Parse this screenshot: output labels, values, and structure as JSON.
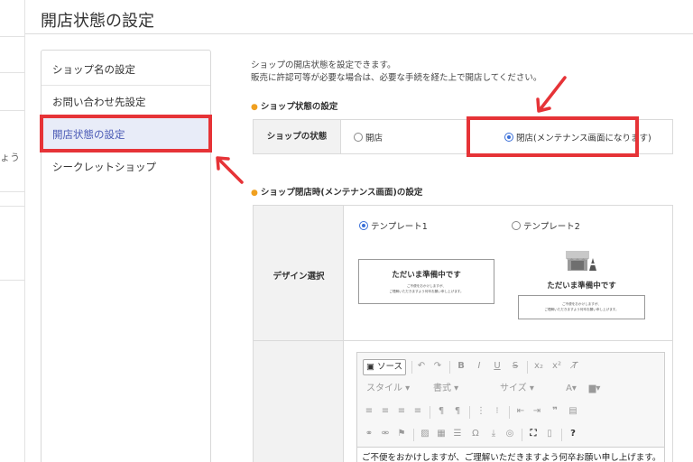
{
  "background": {
    "partial_glyph": "ょう"
  },
  "header": {
    "title": "開店状態の設定"
  },
  "sidebar": {
    "items": [
      {
        "label": "ショップ名の設定",
        "active": false
      },
      {
        "label": "お問い合わせ先設定",
        "active": false
      },
      {
        "label": "開店状態の設定",
        "active": true
      },
      {
        "label": "シークレットショップ",
        "active": false
      }
    ]
  },
  "intro": {
    "line1": "ショップの開店状態を設定できます。",
    "line2": "販売に許認可等が必要な場合は、必要な手続を経た上で開店してください。"
  },
  "shop_state": {
    "section_title": "ショップ状態の設定",
    "row_label": "ショップの状態",
    "options": [
      {
        "label": "開店",
        "selected": false
      },
      {
        "label": "閉店(メンテナンス画面になります)",
        "selected": true
      }
    ]
  },
  "maintenance": {
    "section_title": "ショップ閉店時(メンテナンス画面)の設定",
    "design_label": "デザイン選択",
    "templates": [
      {
        "label": "テンプレート1",
        "selected": true,
        "preview_title": "ただいま準備中です",
        "preview_line1": "ご不便をおかけしますが、",
        "preview_line2": "ご理解いただきますよう何卒お願い申し上げます。"
      },
      {
        "label": "テンプレート2",
        "selected": false,
        "preview_title": "ただいま準備中です",
        "preview_line1": "ご不便をおかけしますが、",
        "preview_line2": "ご理解いただきますよう何卒お願い申し上げます。",
        "icon": "shop-closed-icon"
      }
    ]
  },
  "editor": {
    "source_label": "ソース",
    "style_label": "スタイル",
    "format_label": "書式",
    "size_label": "サイズ",
    "body_text": "ご不便をおかけしますが、ご理解いただきますよう何卒お願い申し上げます。"
  },
  "colors": {
    "accent_red": "#e63337",
    "active_bg": "#e8ecf8",
    "active_text": "#4a5ab5",
    "section_dot": "#f0a020",
    "radio_on": "#3a6fd8"
  }
}
